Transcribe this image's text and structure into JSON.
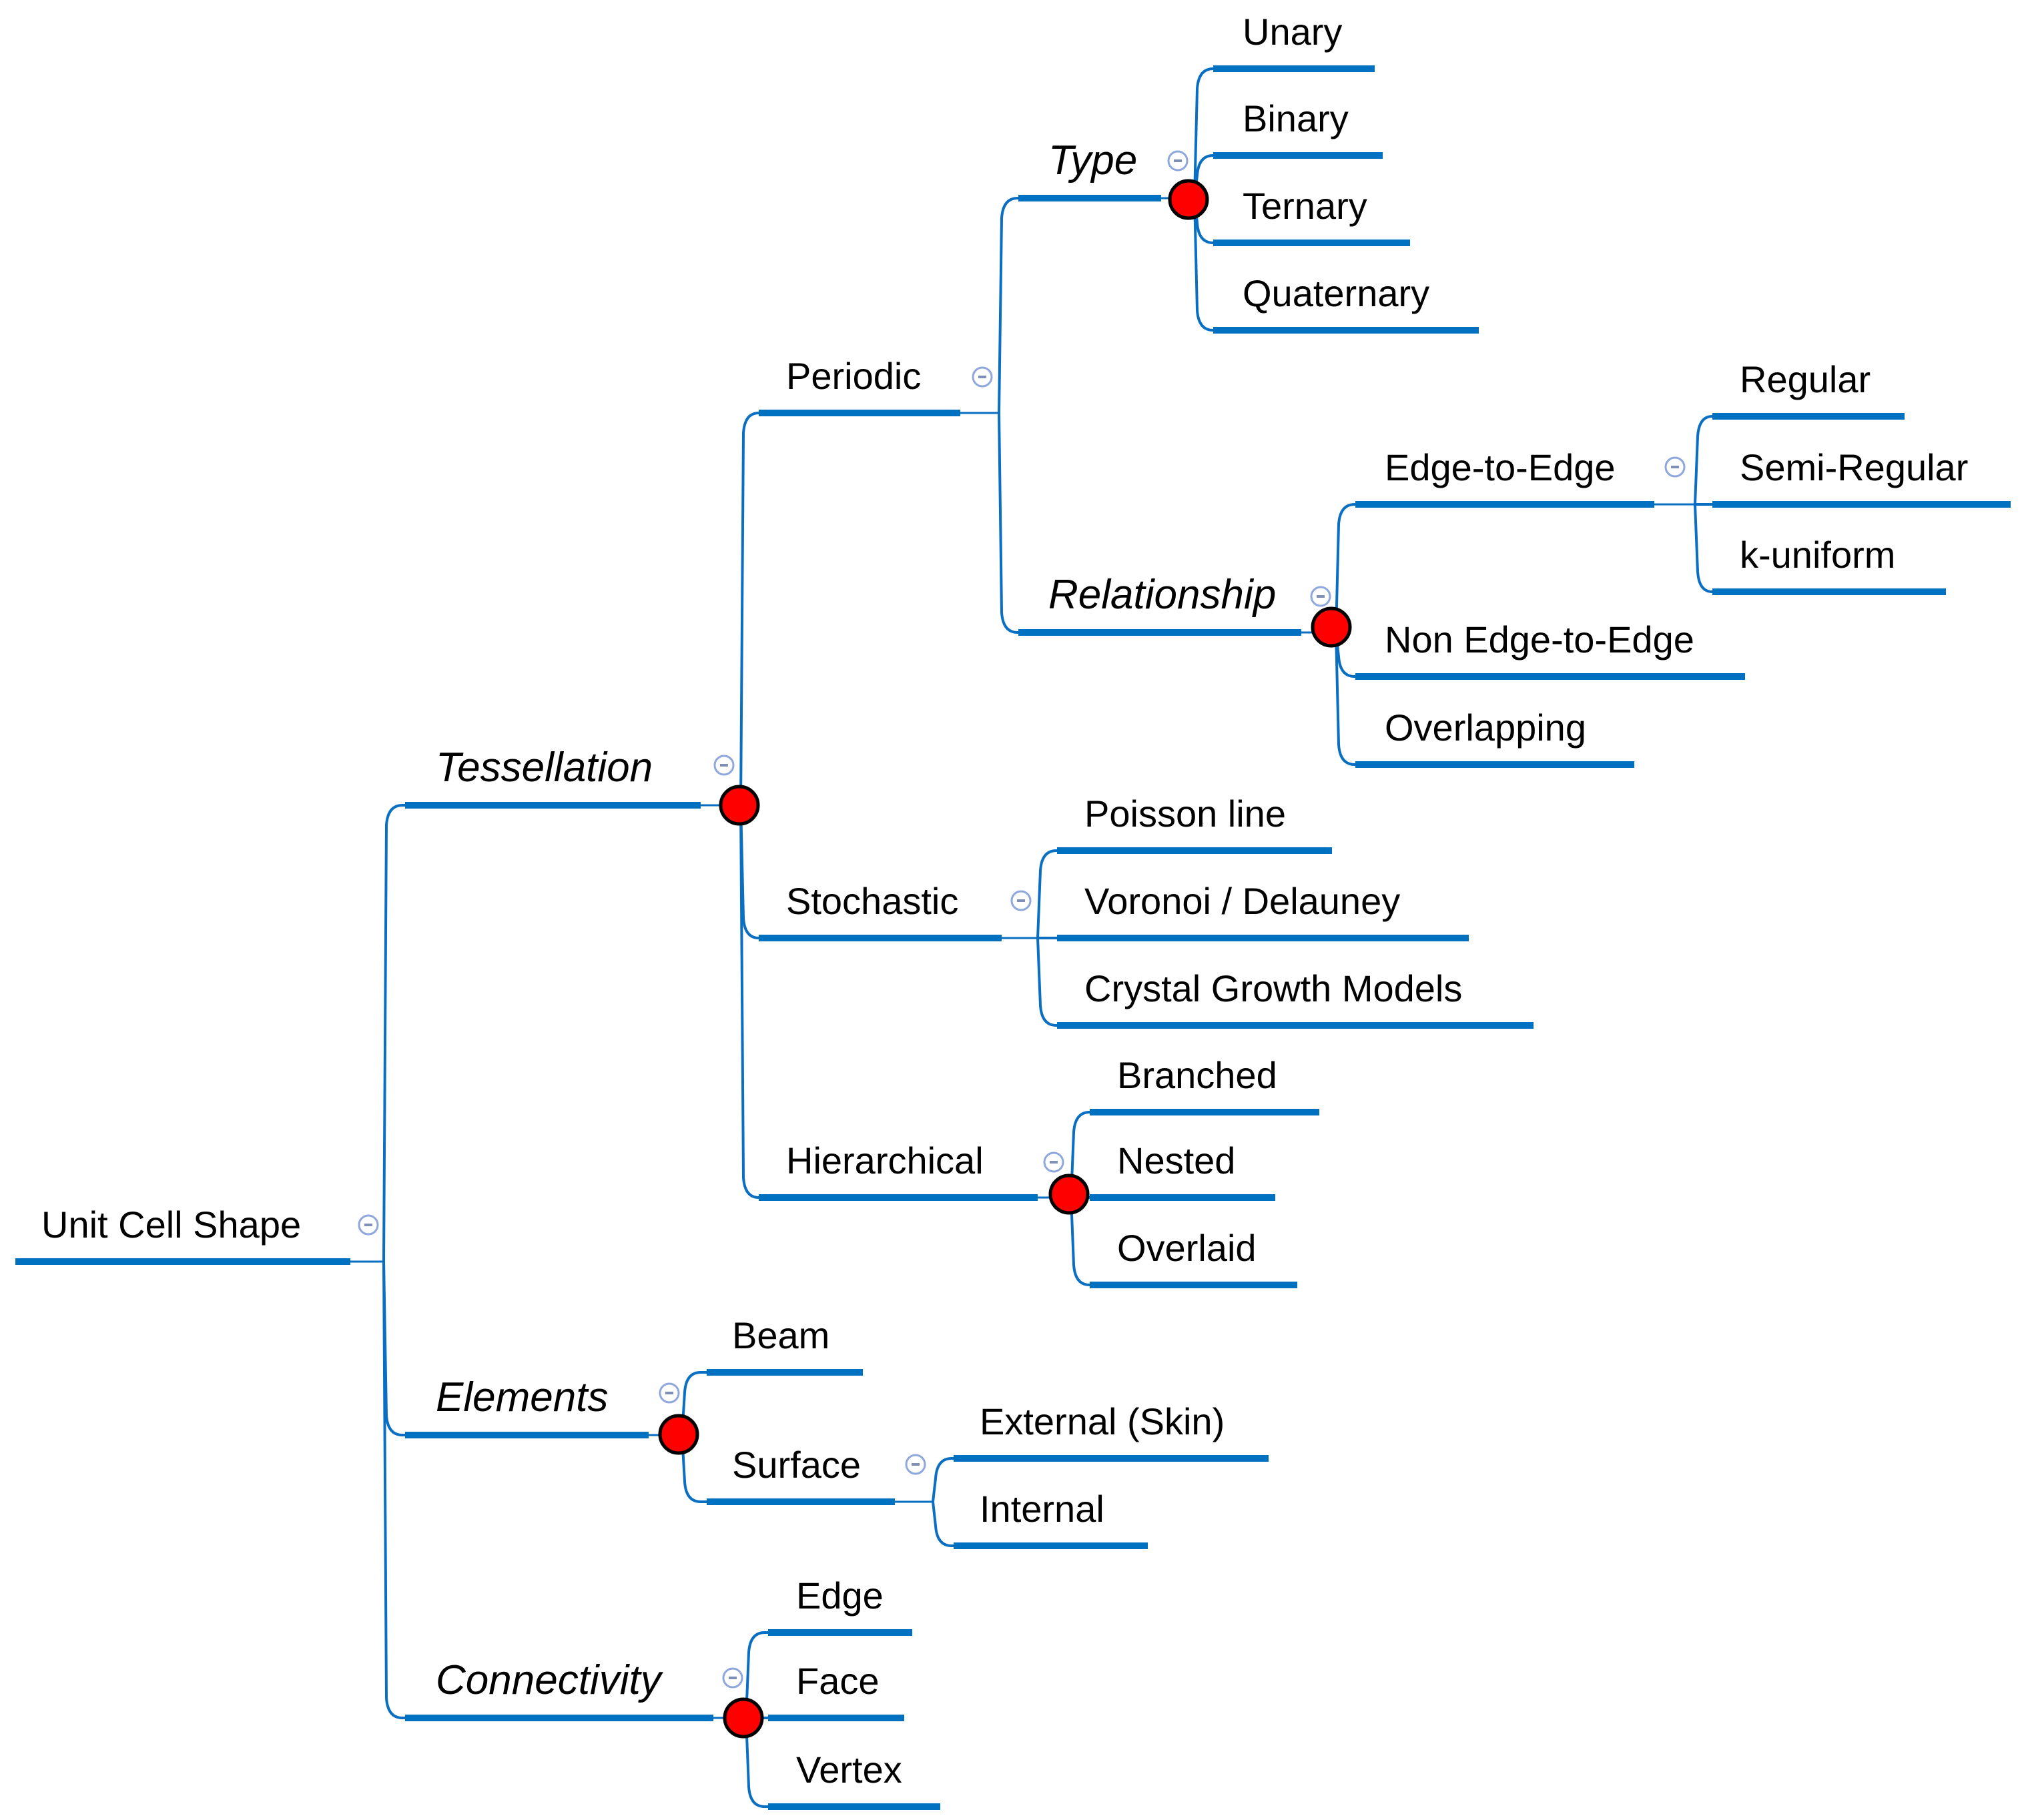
{
  "title": "Unit Cell Shape",
  "colors": {
    "branch": "#0070c0",
    "marker": "#ff0000",
    "marker_outline": "#000000",
    "collapse_icon": "#8ea7dd",
    "text": "#000000",
    "background": "#ffffff"
  },
  "tree": {
    "label": "Unit Cell Shape",
    "italic": false,
    "marker": false,
    "collapsible": true,
    "children": [
      {
        "label": "Tessellation",
        "italic": true,
        "marker": true,
        "collapsible": true,
        "children": [
          {
            "label": "Periodic",
            "italic": false,
            "marker": false,
            "collapsible": true,
            "children": [
              {
                "label": "Type",
                "italic": true,
                "marker": true,
                "collapsible": true,
                "children": [
                  {
                    "label": "Unary"
                  },
                  {
                    "label": "Binary"
                  },
                  {
                    "label": "Ternary"
                  },
                  {
                    "label": "Quaternary"
                  }
                ]
              },
              {
                "label": "Relationship",
                "italic": true,
                "marker": true,
                "collapsible": true,
                "children": [
                  {
                    "label": "Edge-to-Edge",
                    "italic": false,
                    "marker": false,
                    "collapsible": true,
                    "children": [
                      {
                        "label": "Regular"
                      },
                      {
                        "label": "Semi-Regular"
                      },
                      {
                        "label": "k-uniform"
                      }
                    ]
                  },
                  {
                    "label": "Non Edge-to-Edge"
                  },
                  {
                    "label": "Overlapping"
                  }
                ]
              }
            ]
          },
          {
            "label": "Stochastic",
            "italic": false,
            "marker": false,
            "collapsible": true,
            "children": [
              {
                "label": "Poisson line"
              },
              {
                "label": "Voronoi / Delauney"
              },
              {
                "label": "Crystal Growth Models"
              }
            ]
          },
          {
            "label": "Hierarchical",
            "italic": false,
            "marker": true,
            "collapsible": true,
            "children": [
              {
                "label": "Branched"
              },
              {
                "label": "Nested"
              },
              {
                "label": "Overlaid"
              }
            ]
          }
        ]
      },
      {
        "label": "Elements",
        "italic": true,
        "marker": true,
        "collapsible": true,
        "children": [
          {
            "label": "Beam"
          },
          {
            "label": "Surface",
            "italic": false,
            "marker": false,
            "collapsible": true,
            "children": [
              {
                "label": "External (Skin)"
              },
              {
                "label": "Internal"
              }
            ]
          }
        ]
      },
      {
        "label": "Connectivity",
        "italic": true,
        "marker": true,
        "collapsible": true,
        "children": [
          {
            "label": "Edge"
          },
          {
            "label": "Face"
          },
          {
            "label": "Vertex"
          }
        ]
      }
    ]
  }
}
